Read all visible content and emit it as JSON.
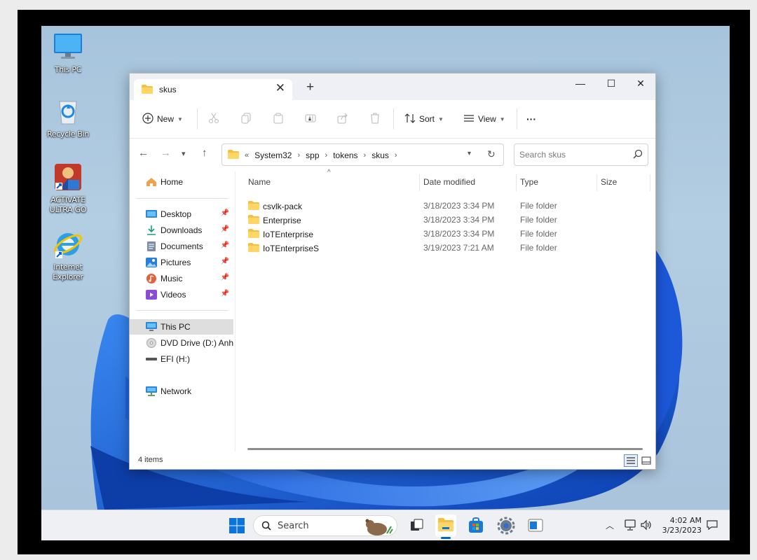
{
  "desktop": {
    "icons": [
      {
        "label": "This PC",
        "icon": "monitor-icon"
      },
      {
        "label": "Recycle Bin",
        "icon": "recycle-bin-icon"
      },
      {
        "label": "ACTIVATE ULTRA GO",
        "icon": "shortcut-app-icon"
      },
      {
        "label": "Internet Explorer",
        "icon": "internet-explorer-icon"
      }
    ]
  },
  "window": {
    "tab_title": "skus",
    "new_tab": "+",
    "controls": {
      "minimize": "—",
      "maximize": "☐",
      "close": "✕"
    }
  },
  "toolbar": {
    "new_label": "New",
    "sort_label": "Sort",
    "view_label": "View",
    "more_label": "···"
  },
  "address": {
    "overflow": "«",
    "crumbs": [
      "System32",
      "spp",
      "tokens",
      "skus"
    ],
    "search_placeholder": "Search skus"
  },
  "nav": {
    "home": "Home",
    "quick": [
      "Desktop",
      "Downloads",
      "Documents",
      "Pictures",
      "Music",
      "Videos"
    ],
    "this_pc": "This PC",
    "dvd": "DVD Drive (D:) Anhdv",
    "efi": "EFI (H:)",
    "network": "Network"
  },
  "columns": {
    "name": "Name",
    "date": "Date modified",
    "type": "Type",
    "size": "Size"
  },
  "files": [
    {
      "name": "csvlk-pack",
      "date": "3/18/2023 3:34 PM",
      "type": "File folder"
    },
    {
      "name": "Enterprise",
      "date": "3/18/2023 3:34 PM",
      "type": "File folder"
    },
    {
      "name": "IoTEnterprise",
      "date": "3/18/2023 3:34 PM",
      "type": "File folder"
    },
    {
      "name": "IoTEnterpriseS",
      "date": "3/19/2023 7:21 AM",
      "type": "File folder"
    }
  ],
  "status": {
    "item_count": "4 items"
  },
  "taskbar": {
    "search_label": "Search",
    "time": "4:02 AM",
    "date": "3/23/2023"
  },
  "colors": {
    "accent": "#0067c0",
    "folder": "#f4c042",
    "wallpaper": "#1a5fd6"
  }
}
